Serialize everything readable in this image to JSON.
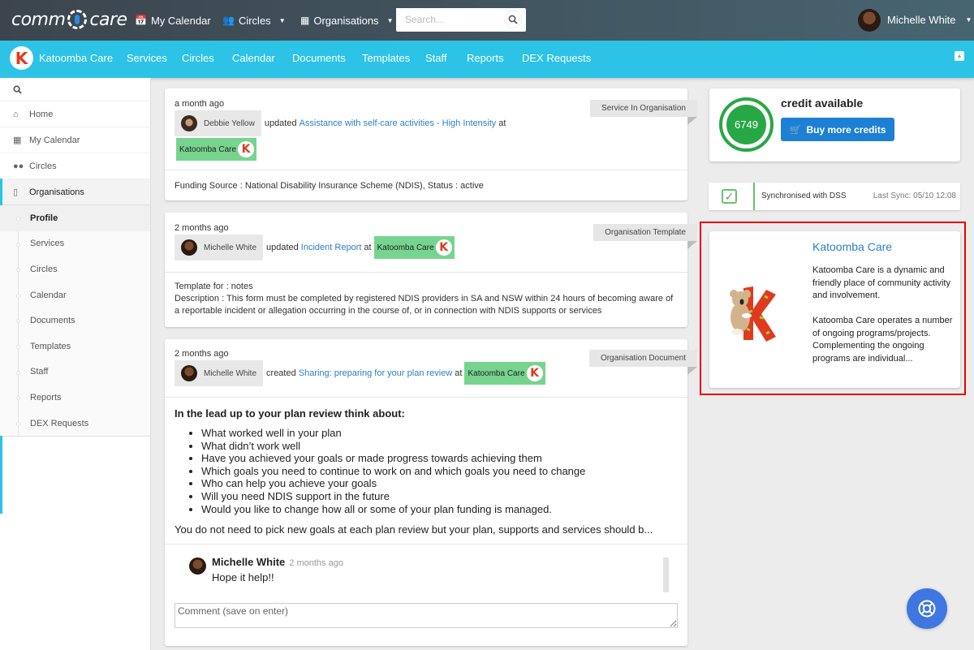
{
  "topbar": {
    "logo_left": "comm",
    "logo_right": "care",
    "nav": [
      {
        "label": "My Calendar",
        "icon": "calendar-icon"
      },
      {
        "label": "Circles",
        "icon": "users-icon",
        "has_dropdown": true
      },
      {
        "label": "Organisations",
        "icon": "building-icon",
        "has_dropdown": true
      }
    ],
    "search_placeholder": "Search...",
    "user_name": "Michelle White"
  },
  "orgbar": {
    "org_name": "Katoomba Care",
    "items": [
      "Services",
      "Circles",
      "Calendar",
      "Documents",
      "Templates",
      "Staff",
      "Reports",
      "DEX Requests"
    ]
  },
  "sidebar": {
    "items": [
      {
        "label": "Home",
        "icon": "home-icon"
      },
      {
        "label": "My Calendar",
        "icon": "calendar-icon"
      },
      {
        "label": "Circles",
        "icon": "users-icon"
      },
      {
        "label": "Organisations",
        "icon": "tablet-icon",
        "active": true
      }
    ],
    "subitems": [
      {
        "label": "Profile",
        "active": true
      },
      {
        "label": "Services"
      },
      {
        "label": "Circles"
      },
      {
        "label": "Calendar"
      },
      {
        "label": "Documents"
      },
      {
        "label": "Templates"
      },
      {
        "label": "Staff"
      },
      {
        "label": "Reports"
      },
      {
        "label": "DEX Requests"
      }
    ]
  },
  "feed": [
    {
      "when": "a month ago",
      "person": "Debbie Yellow",
      "action": "updated",
      "link": "Assistance with self-care activities - High Intensity",
      "at": "at",
      "org": "Katoomba Care",
      "type": "Service In Organisation",
      "body": "Funding Source : National Disability Insurance Scheme (NDIS), Status : active"
    },
    {
      "when": "2 months ago",
      "person": "Michelle White",
      "action": "updated",
      "link": "Incident Report",
      "at": "at",
      "org": "Katoomba Care",
      "type": "Organisation Template",
      "body_line1": "Template for : notes",
      "body_line2": "Description : This form must be completed by registered NDIS providers in SA and NSW within 24 hours of becoming aware of a reportable incident or allegation occurring in the course of, or in connection with NDIS supports or services"
    },
    {
      "when": "2 months ago",
      "person": "Michelle White",
      "action": "created",
      "link": "Sharing: preparing for your plan review",
      "at": "at",
      "org": "Katoomba Care",
      "type": "Organisation Document",
      "heading": "In the lead up to your plan review think about:",
      "bullets": [
        "What worked well in your plan",
        "What didn’t work well",
        "Have you achieved your goals or made progress towards achieving them",
        "Which goals you need to continue to work on and which goals you need to change",
        "Who can help you achieve your goals",
        "Will you need NDIS support in the future",
        "Would you like to change how all or some of your plan funding is managed."
      ],
      "footer": "You do not need to pick new goals at each plan review but your plan, supports and services should b...",
      "comments": [
        {
          "author": "Michelle White",
          "when": "2 months ago",
          "text": "Hope it help!!"
        }
      ],
      "comment_placeholder": "Comment (save on enter)"
    }
  ],
  "credit": {
    "amount": "6749",
    "title": "credit available",
    "buy_label": "Buy more credits",
    "color": "#28a745"
  },
  "sync": {
    "label": "Synchronised with DSS",
    "last_sync": "Last Sync: 05/10 12:08"
  },
  "org_card": {
    "name": "Katoomba Care",
    "description": "Katoomba Care is a dynamic and friendly place of community activity and involvement.\n\nKatoomba Care operates a number of ongoing programs/projects. Complementing the ongoing programs are individual..."
  },
  "colors": {
    "orgbar": "#2cc3e6",
    "link": "#2a7fc7",
    "org_tag": "#77d48f",
    "buy_button": "#1e80d4",
    "help_button": "#3e77e1",
    "highlight": "#ee0000"
  }
}
